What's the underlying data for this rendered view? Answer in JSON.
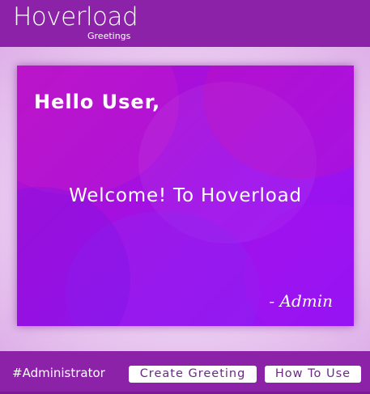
{
  "header": {
    "logo_text": "Hoverload",
    "logo_subtext": "Greetings"
  },
  "greeting_card": {
    "title": "Hello User,",
    "message": "Welcome! To Hoverload",
    "signature": "- Admin"
  },
  "footer": {
    "username": "#Administrator",
    "create_button_label": "Create Greeting",
    "how_to_button_label": "How To Use"
  },
  "colors": {
    "brand_purple": "#8b22a8",
    "card_gradient_start": "#b312c9",
    "card_gradient_end": "#8f14f6",
    "button_text": "#6a2a82"
  }
}
